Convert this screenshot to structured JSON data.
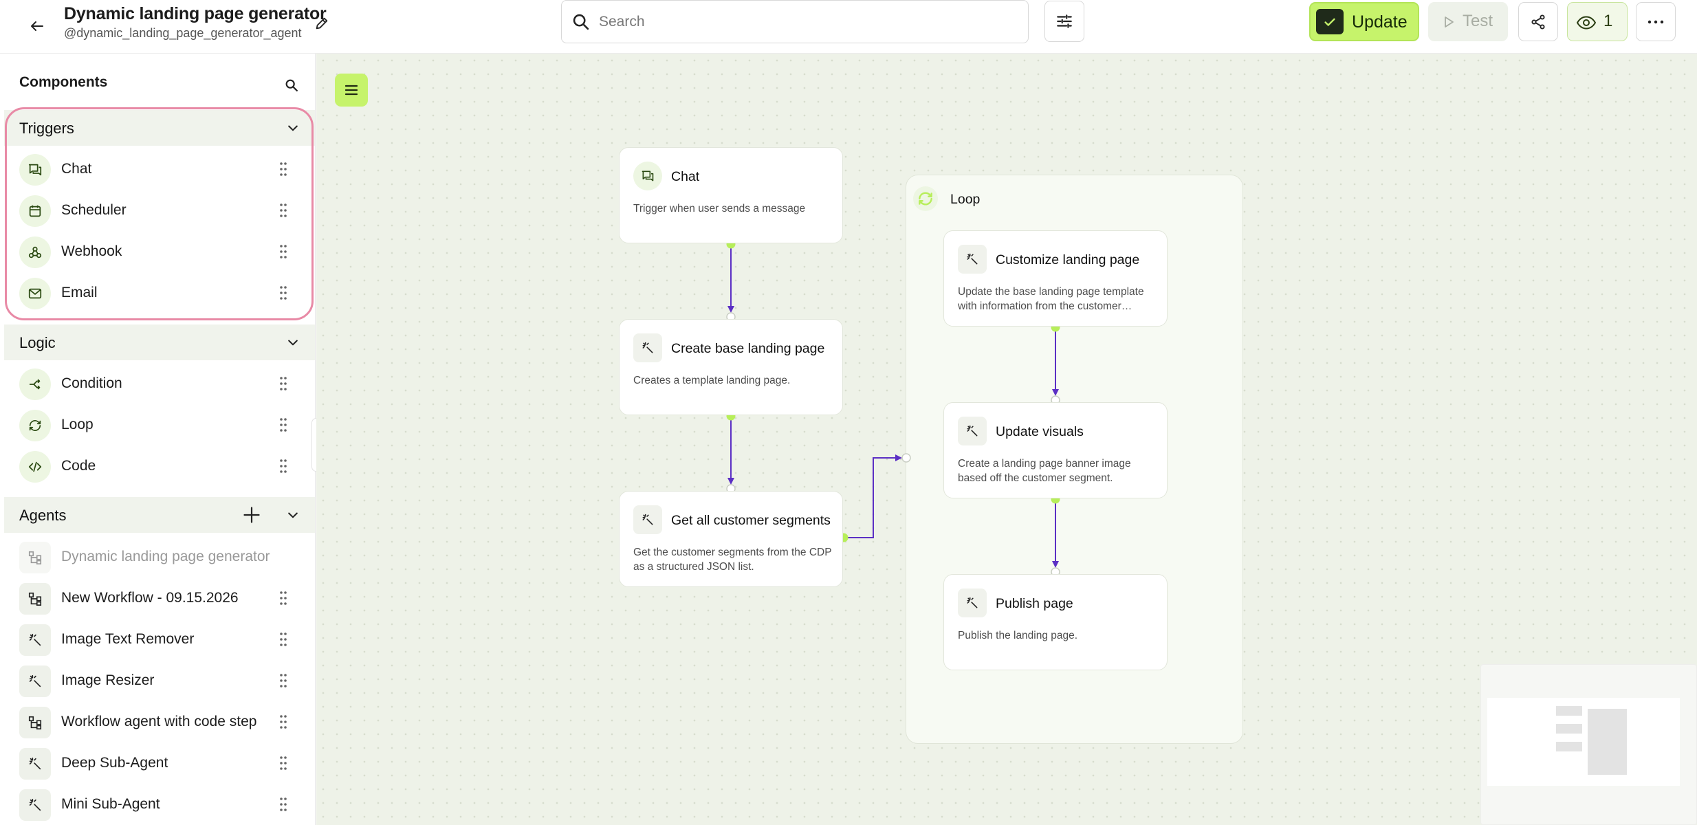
{
  "header": {
    "title": "Dynamic landing page generator",
    "handle": "@dynamic_landing_page_generator_agent",
    "search_placeholder": "Search",
    "update_label": "Update",
    "test_label": "Test",
    "viewer_count": "1"
  },
  "sidebar": {
    "title": "Components",
    "sections": {
      "triggers": {
        "title": "Triggers",
        "items": [
          {
            "label": "Chat",
            "icon": "chat-icon"
          },
          {
            "label": "Scheduler",
            "icon": "calendar-icon"
          },
          {
            "label": "Webhook",
            "icon": "webhook-icon"
          },
          {
            "label": "Email",
            "icon": "mail-icon"
          }
        ]
      },
      "logic": {
        "title": "Logic",
        "items": [
          {
            "label": "Condition",
            "icon": "branch-icon"
          },
          {
            "label": "Loop",
            "icon": "loop-icon"
          },
          {
            "label": "Code",
            "icon": "code-icon"
          }
        ]
      },
      "agents": {
        "title": "Agents",
        "items": [
          {
            "label": "Dynamic landing page generator",
            "icon": "workflow-icon",
            "disabled": true
          },
          {
            "label": "New Workflow - 09.15.2026",
            "icon": "workflow-icon"
          },
          {
            "label": "Image Text Remover",
            "icon": "sparkle-icon"
          },
          {
            "label": "Image Resizer",
            "icon": "sparkle-icon"
          },
          {
            "label": "Workflow agent with code step",
            "icon": "workflow-icon"
          },
          {
            "label": "Deep Sub-Agent",
            "icon": "sparkle-icon"
          },
          {
            "label": "Mini Sub-Agent",
            "icon": "sparkle-icon"
          }
        ]
      }
    }
  },
  "canvas": {
    "nodes": {
      "chat": {
        "title": "Chat",
        "desc": "Trigger when user sends a message"
      },
      "create_base": {
        "title": "Create base landing page",
        "desc": "Creates a template landing page."
      },
      "get_segments": {
        "title": "Get all customer segments",
        "desc": "Get the customer segments from the CDP as a structured JSON list."
      },
      "customize": {
        "title": "Customize landing page",
        "desc": "Update the base landing page template with information from the customer…"
      },
      "update_visuals": {
        "title": "Update visuals",
        "desc": "Create a landing page banner image based off the customer segment."
      },
      "publish": {
        "title": "Publish page",
        "desc": "Publish the landing page."
      }
    },
    "loop": {
      "title": "Loop"
    }
  },
  "colors": {
    "accent": "#c6f36b",
    "edge": "#5b2fc4",
    "port": "#b7ee5a",
    "highlight": "#e88aa6",
    "canvas_bg": "#eef2e8"
  }
}
